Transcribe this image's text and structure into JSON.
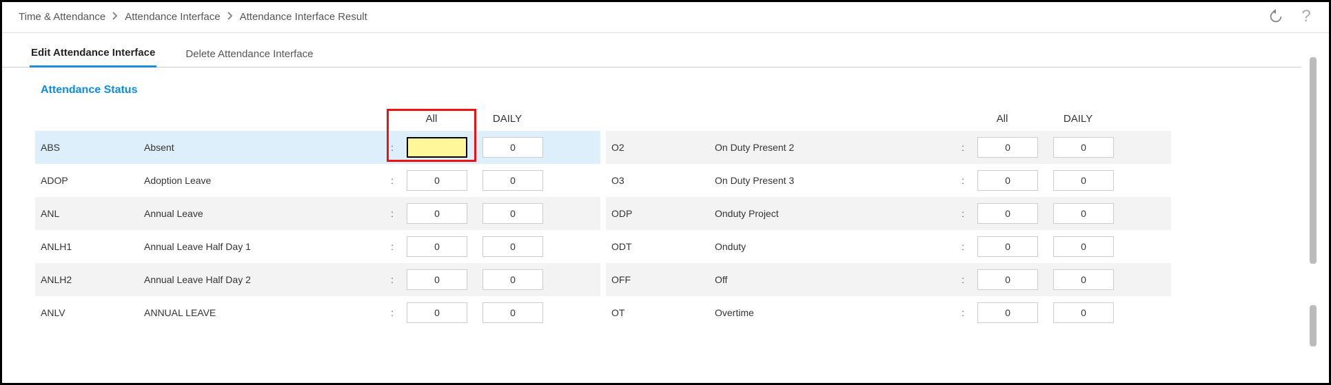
{
  "breadcrumb": {
    "item1": "Time & Attendance",
    "item2": "Attendance Interface",
    "item3": "Attendance Interface Result"
  },
  "tabs": {
    "edit": "Edit Attendance Interface",
    "delete": "Delete Attendance Interface"
  },
  "section": {
    "heading": "Attendance Status"
  },
  "headers": {
    "all": "All",
    "daily": "DAILY"
  },
  "left_rows": [
    {
      "code": "ABS",
      "desc": "Absent",
      "all": "",
      "daily": "0",
      "selected": true,
      "highlight": true
    },
    {
      "code": "ADOP",
      "desc": "Adoption Leave",
      "all": "0",
      "daily": "0"
    },
    {
      "code": "ANL",
      "desc": "Annual Leave",
      "all": "0",
      "daily": "0",
      "shade": true
    },
    {
      "code": "ANLH1",
      "desc": "Annual Leave Half Day 1",
      "all": "0",
      "daily": "0"
    },
    {
      "code": "ANLH2",
      "desc": "Annual Leave Half Day 2",
      "all": "0",
      "daily": "0",
      "shade": true
    },
    {
      "code": "ANLV",
      "desc": "ANNUAL LEAVE",
      "all": "0",
      "daily": "0"
    }
  ],
  "right_rows": [
    {
      "code": "O2",
      "desc": "On Duty Present 2",
      "all": "0",
      "daily": "0",
      "shade": true
    },
    {
      "code": "O3",
      "desc": "On Duty Present 3",
      "all": "0",
      "daily": "0"
    },
    {
      "code": "ODP",
      "desc": "Onduty Project",
      "all": "0",
      "daily": "0",
      "shade": true
    },
    {
      "code": "ODT",
      "desc": "Onduty",
      "all": "0",
      "daily": "0"
    },
    {
      "code": "OFF",
      "desc": "Off",
      "all": "0",
      "daily": "0",
      "shade": true
    },
    {
      "code": "OT",
      "desc": "Overtime",
      "all": "0",
      "daily": "0"
    }
  ],
  "icons": {
    "refresh": "refresh",
    "help": "?"
  },
  "highlight_box": {
    "note": "red rectangle around the All header + first All input in left column"
  }
}
